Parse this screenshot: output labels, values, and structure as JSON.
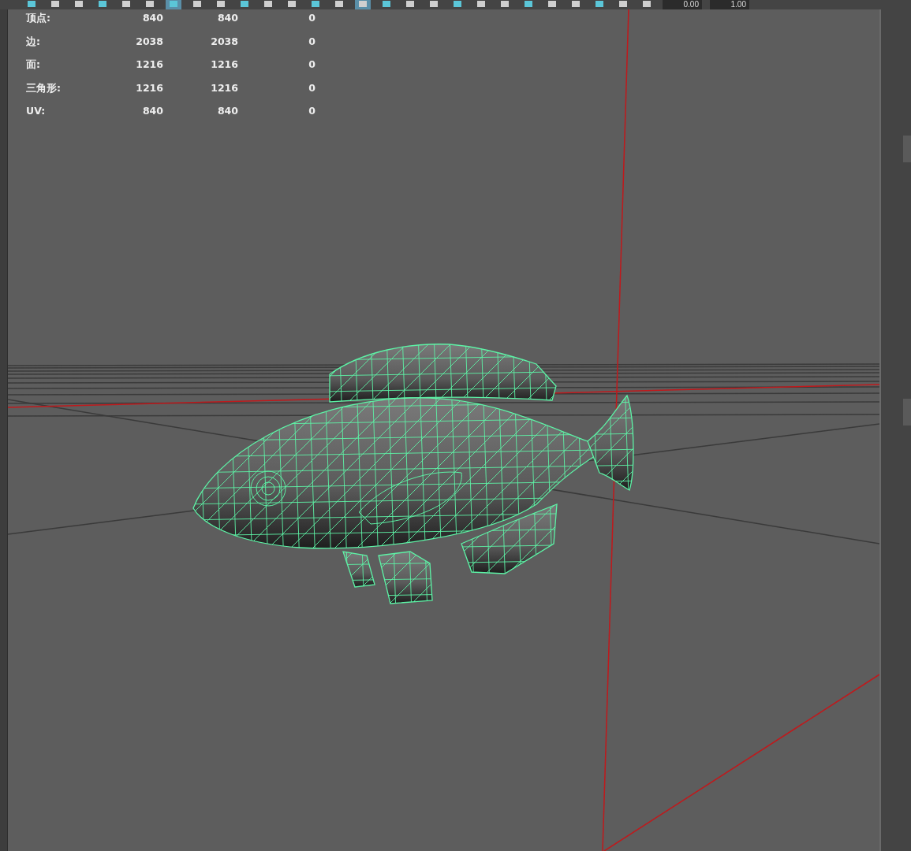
{
  "toolbar": {
    "buttons": [
      {
        "selected": false
      },
      {
        "selected": false
      },
      {
        "selected": false
      },
      {
        "selected": false
      },
      {
        "selected": false
      },
      {
        "selected": false
      },
      {
        "selected": true
      },
      {
        "selected": false
      },
      {
        "selected": false
      },
      {
        "selected": false
      },
      {
        "selected": false
      },
      {
        "selected": false
      },
      {
        "selected": false
      },
      {
        "selected": false
      },
      {
        "selected": true
      },
      {
        "selected": false
      },
      {
        "selected": false
      },
      {
        "selected": false
      },
      {
        "selected": false
      },
      {
        "selected": false
      },
      {
        "selected": false
      },
      {
        "selected": false
      },
      {
        "selected": false
      },
      {
        "selected": false
      },
      {
        "selected": false
      },
      {
        "selected": false
      },
      {
        "selected": false
      }
    ],
    "fields": [
      {
        "value": "0.00"
      },
      {
        "value": "1.00"
      }
    ]
  },
  "heads_up_display": {
    "rows": [
      {
        "label": "顶点:",
        "values": [
          "840",
          "840",
          "0"
        ]
      },
      {
        "label": "边:",
        "values": [
          "2038",
          "2038",
          "0"
        ]
      },
      {
        "label": "面:",
        "values": [
          "1216",
          "1216",
          "0"
        ]
      },
      {
        "label": "三角形:",
        "values": [
          "1216",
          "1216",
          "0"
        ]
      },
      {
        "label": "UV:",
        "values": [
          "840",
          "840",
          "0"
        ]
      }
    ]
  }
}
